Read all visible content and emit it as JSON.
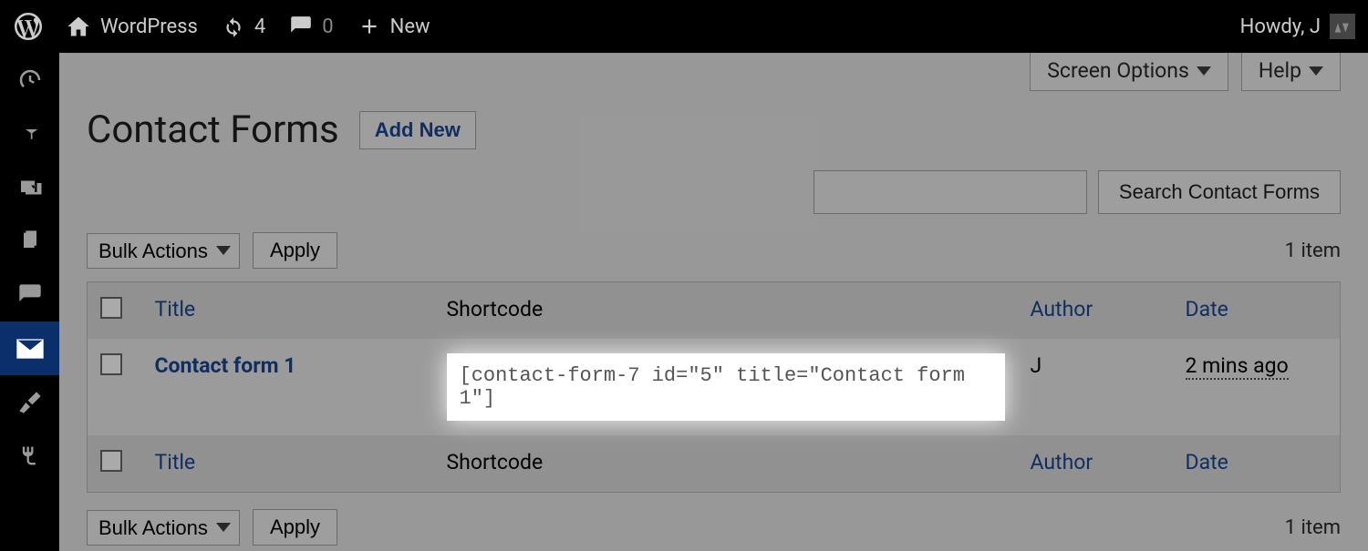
{
  "adminbar": {
    "site_name": "WordPress",
    "updates_count": "4",
    "comments_count": "0",
    "new_label": "New",
    "howdy": "Howdy, J"
  },
  "sidebar": {
    "items": [
      {
        "name": "dashboard-icon"
      },
      {
        "name": "pin-icon"
      },
      {
        "name": "media-icon"
      },
      {
        "name": "pages-icon"
      },
      {
        "name": "comments-icon"
      },
      {
        "name": "mail-icon",
        "active": true
      },
      {
        "name": "appearance-icon"
      },
      {
        "name": "plugins-icon"
      }
    ]
  },
  "screen_meta": {
    "screen_options_label": "Screen Options",
    "help_label": "Help"
  },
  "page": {
    "title": "Contact Forms",
    "add_new_label": "Add New"
  },
  "search": {
    "value": "",
    "button_label": "Search Contact Forms"
  },
  "bulk": {
    "selected": "Bulk Actions",
    "apply_label": "Apply"
  },
  "item_count": "1 item",
  "columns": {
    "title": "Title",
    "shortcode": "Shortcode",
    "author": "Author",
    "date": "Date"
  },
  "rows": [
    {
      "title": "Contact form 1",
      "shortcode": "[contact-form-7 id=\"5\" title=\"Contact form 1\"]",
      "author": "J",
      "date": "2 mins ago"
    }
  ]
}
